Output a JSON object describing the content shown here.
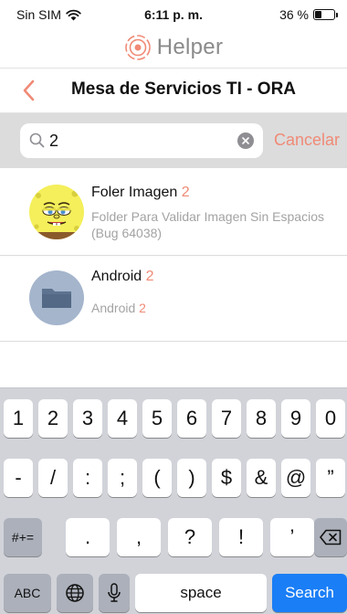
{
  "status_bar": {
    "carrier": "Sin SIM",
    "time": "6:11 p. m.",
    "battery": "36 %",
    "battery_level": 0.36
  },
  "app": {
    "logo_text": "Helper",
    "accent_color": "#f08a76"
  },
  "navbar": {
    "title": "Mesa de Servicios TI - ORA"
  },
  "search": {
    "value": "2",
    "cancel_label": "Cancelar"
  },
  "results": [
    {
      "title": "Foler Imagen",
      "title_match": "2",
      "subtitle_line1": "Folder Para Validar Imagen Sin Espacios",
      "subtitle_line2": "(Bug 64038)",
      "subtitle_match": "",
      "avatar": "sponge-character-avatar"
    },
    {
      "title": "Android",
      "title_match": "2",
      "subtitle_line1": "Android",
      "subtitle_line2": "",
      "subtitle_match": "2",
      "avatar": "folder-icon"
    }
  ],
  "keyboard": {
    "row1": [
      "1",
      "2",
      "3",
      "4",
      "5",
      "6",
      "7",
      "8",
      "9",
      "0"
    ],
    "row2": [
      "-",
      "/",
      ":",
      ";",
      "(",
      ")",
      "$",
      "&",
      "@",
      "”"
    ],
    "row3_mode": "#+=",
    "row3": [
      ".",
      ",",
      "?",
      "!",
      "’"
    ],
    "abc": "ABC",
    "space": "space",
    "search": "Search"
  }
}
